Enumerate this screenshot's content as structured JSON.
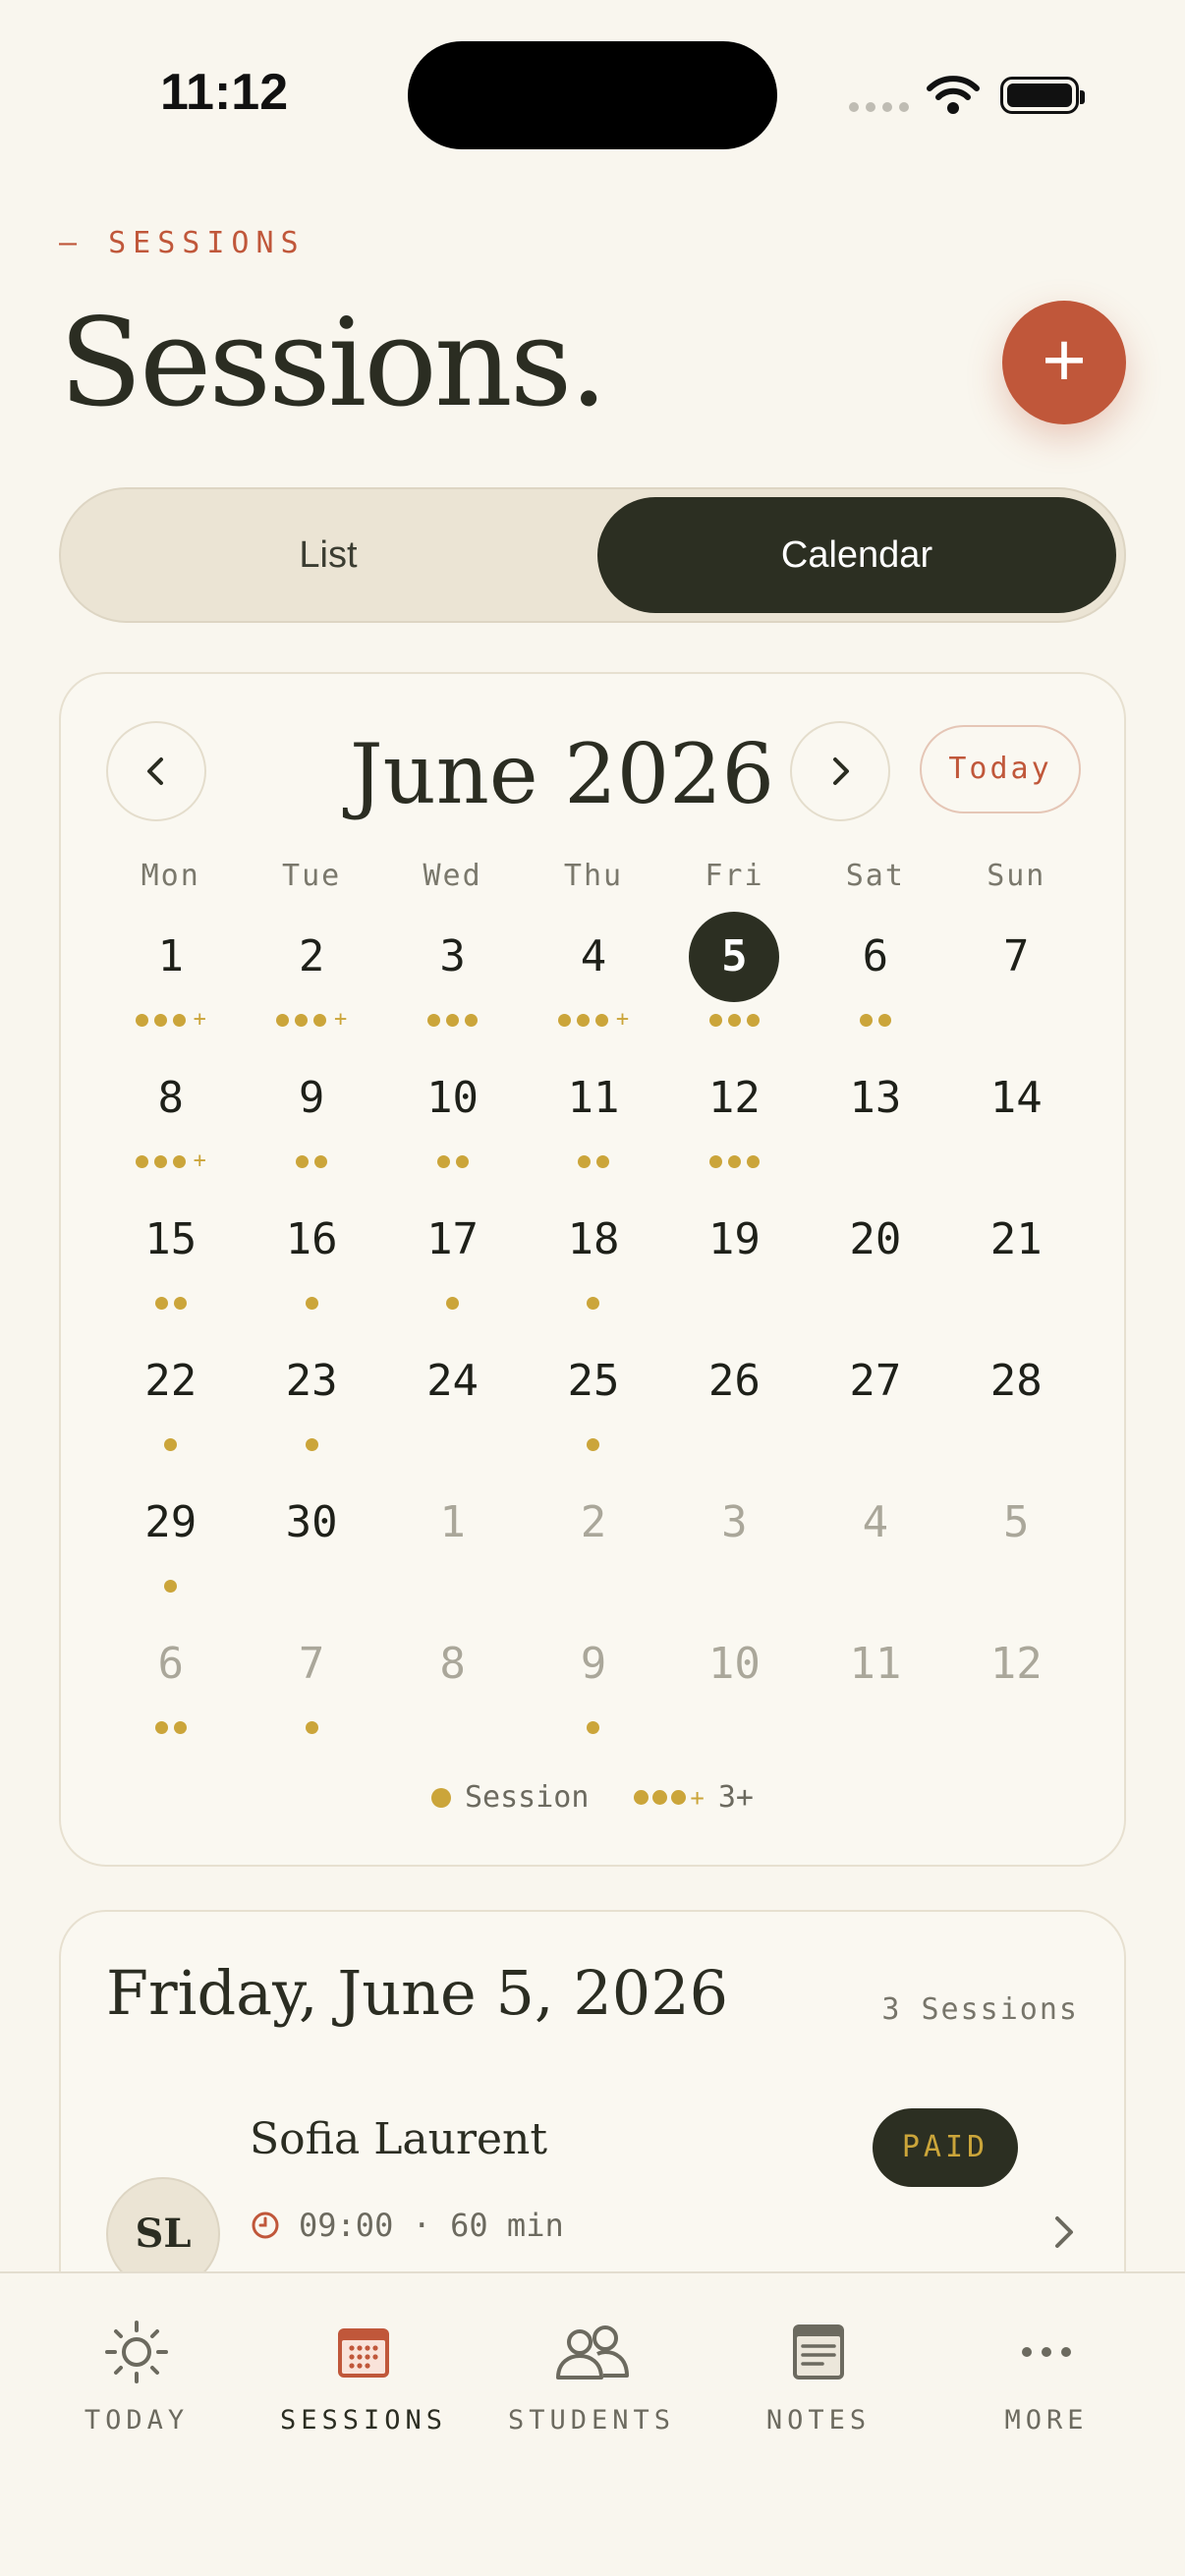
{
  "status": {
    "time": "11:12"
  },
  "header": {
    "eyebrow": "— SESSIONS",
    "title": "Sessions.",
    "add_label": "+"
  },
  "view_toggle": {
    "list": "List",
    "calendar": "Calendar",
    "selected": "Calendar"
  },
  "calendar": {
    "month_title": "June 2026",
    "today_label": "Today",
    "weekdays": [
      "Mon",
      "Tue",
      "Wed",
      "Thu",
      "Fri",
      "Sat",
      "Sun"
    ],
    "selected_day": "5",
    "days": [
      {
        "n": "1",
        "dots": 3,
        "plus": true
      },
      {
        "n": "2",
        "dots": 3,
        "plus": true
      },
      {
        "n": "3",
        "dots": 3
      },
      {
        "n": "4",
        "dots": 3,
        "plus": true
      },
      {
        "n": "5",
        "dots": 3,
        "selected": true
      },
      {
        "n": "6",
        "dots": 2
      },
      {
        "n": "7",
        "dots": 0
      },
      {
        "n": "8",
        "dots": 3,
        "plus": true
      },
      {
        "n": "9",
        "dots": 2
      },
      {
        "n": "10",
        "dots": 2
      },
      {
        "n": "11",
        "dots": 2
      },
      {
        "n": "12",
        "dots": 3
      },
      {
        "n": "13",
        "dots": 0
      },
      {
        "n": "14",
        "dots": 0
      },
      {
        "n": "15",
        "dots": 2
      },
      {
        "n": "16",
        "dots": 1
      },
      {
        "n": "17",
        "dots": 1
      },
      {
        "n": "18",
        "dots": 1
      },
      {
        "n": "19",
        "dots": 0
      },
      {
        "n": "20",
        "dots": 0
      },
      {
        "n": "21",
        "dots": 0
      },
      {
        "n": "22",
        "dots": 1
      },
      {
        "n": "23",
        "dots": 1
      },
      {
        "n": "24",
        "dots": 0
      },
      {
        "n": "25",
        "dots": 1
      },
      {
        "n": "26",
        "dots": 0
      },
      {
        "n": "27",
        "dots": 0
      },
      {
        "n": "28",
        "dots": 0
      },
      {
        "n": "29",
        "dots": 1
      },
      {
        "n": "30",
        "dots": 0
      },
      {
        "n": "1",
        "dots": 0,
        "out": true
      },
      {
        "n": "2",
        "dots": 0,
        "out": true
      },
      {
        "n": "3",
        "dots": 0,
        "out": true
      },
      {
        "n": "4",
        "dots": 0,
        "out": true
      },
      {
        "n": "5",
        "dots": 0,
        "out": true
      },
      {
        "n": "6",
        "dots": 2,
        "out": true
      },
      {
        "n": "7",
        "dots": 1,
        "out": true
      },
      {
        "n": "8",
        "dots": 0,
        "out": true
      },
      {
        "n": "9",
        "dots": 1,
        "out": true
      },
      {
        "n": "10",
        "dots": 0,
        "out": true
      },
      {
        "n": "11",
        "dots": 0,
        "out": true
      },
      {
        "n": "12",
        "dots": 0,
        "out": true
      }
    ],
    "legend": {
      "session": "Session",
      "many": "3+"
    }
  },
  "day": {
    "title": "Friday, June 5, 2026",
    "count": "3 Sessions",
    "sessions": [
      {
        "initials": "SL",
        "name": "Sofia Laurent",
        "status": "PAID",
        "time": "09:00 · 60 min"
      }
    ]
  },
  "tabs": [
    {
      "label": "TODAY",
      "icon": "sun-icon"
    },
    {
      "label": "SESSIONS",
      "icon": "calendar-icon",
      "active": true
    },
    {
      "label": "STUDENTS",
      "icon": "users-icon"
    },
    {
      "label": "NOTES",
      "icon": "notes-icon"
    },
    {
      "label": "MORE",
      "icon": "more-icon"
    }
  ],
  "colors": {
    "accent": "#c0573a",
    "dark": "#2c2f22",
    "gold": "#cba53a",
    "background": "#f9f6ee"
  }
}
